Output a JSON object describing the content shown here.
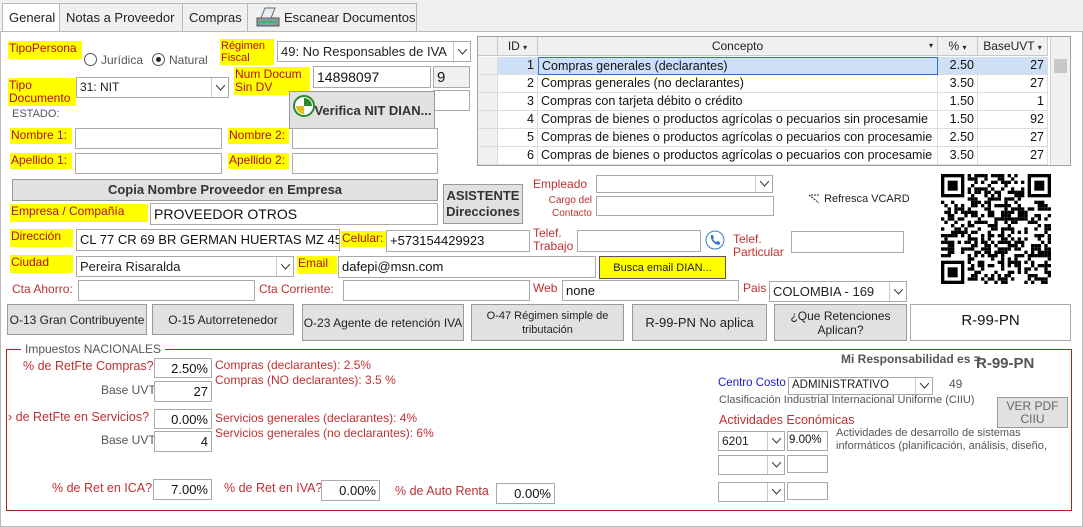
{
  "tabs": [
    {
      "label": "General"
    },
    {
      "label": "Notas a Proveedor"
    },
    {
      "label": "Compras"
    },
    {
      "label": "Escanear Documentos"
    }
  ],
  "tipo_persona": {
    "label": "TipoPersona",
    "opt1": "Jurídica",
    "opt2": "Natural",
    "selected": "Natural"
  },
  "regimen": {
    "label": "Régimen Fiscal",
    "value": "49: No Responsables de IVA"
  },
  "tipo_doc": {
    "label": "Tipo Documento",
    "value": "31: NIT"
  },
  "num_doc": {
    "label": "Num Docum Sin DV",
    "value": "14898097",
    "dv": "9"
  },
  "estado_label": "ESTADO:",
  "verifica_btn": "Verifica NIT DIAN...",
  "nombre1": {
    "label": "Nombre 1:",
    "value": ""
  },
  "nombre2": {
    "label": "Nombre 2:",
    "value": ""
  },
  "apellido1": {
    "label": "Apellido 1:",
    "value": ""
  },
  "apellido2": {
    "label": "Apellido 2:",
    "value": ""
  },
  "copia_btn": "Copia Nombre Proveedor en Empresa",
  "asistente_btn": "ASISTENTE Direcciones",
  "empresa": {
    "label": "Empresa / Compañía",
    "value": "PROVEEDOR OTROS"
  },
  "direccion": {
    "label": "Dirección",
    "value": "CL 77 CR 69 BR GERMAN HUERTAS MZ 45"
  },
  "celular": {
    "label": "Celular:",
    "value": "+573154429923"
  },
  "ciudad": {
    "label": "Ciudad",
    "value": "Pereira Risaralda"
  },
  "email": {
    "label": "Email",
    "value": "dafepi@msn.com"
  },
  "busca_email_btn": "Busca email DIAN...",
  "empleado": {
    "label": "Empleado",
    "value": ""
  },
  "cargo": {
    "label": "Cargo del Contacto",
    "value": ""
  },
  "tel_trabajo": {
    "label": "Telef. Trabajo",
    "value": ""
  },
  "tel_particular": {
    "label": "Telef. Particular",
    "value": ""
  },
  "refresca": "Refresca VCARD",
  "cta_ahorro": {
    "label": "Cta Ahorro:",
    "value": ""
  },
  "cta_corriente": {
    "label": "Cta Corriente:",
    "value": ""
  },
  "web": {
    "label": "Web",
    "value": "none"
  },
  "pais": {
    "label": "Pais",
    "value": "COLOMBIA - 169"
  },
  "resp_buttons": [
    "O-13 Gran Contribuyente",
    "O-15 Autorretenedor",
    "O-23 Agente de retención IVA",
    "O-47 Régimen simple de tributación",
    "R-99-PN No aplica",
    "¿Que Retenciones Aplican?"
  ],
  "resp_value": "R-99-PN",
  "grid": {
    "headers": [
      "ID",
      "Concepto",
      "%",
      "BaseUVT"
    ],
    "rows": [
      {
        "id": "1",
        "concepto": "Compras generales (declarantes)",
        "pct": "2.50",
        "uvt": "27"
      },
      {
        "id": "2",
        "concepto": "Compras generales (no declarantes)",
        "pct": "3.50",
        "uvt": "27"
      },
      {
        "id": "3",
        "concepto": "Compras con tarjeta débito o crédito",
        "pct": "1.50",
        "uvt": "1"
      },
      {
        "id": "4",
        "concepto": "Compras de bienes o productos agrícolas o pecuarios sin procesamie",
        "pct": "1.50",
        "uvt": "92"
      },
      {
        "id": "5",
        "concepto": "Compras de bienes o productos agrícolas o pecuarios con procesamie",
        "pct": "2.50",
        "uvt": "27"
      },
      {
        "id": "6",
        "concepto": "Compras de bienes o productos agrícolas o pecuarios con procesamie",
        "pct": "3.50",
        "uvt": "27"
      }
    ]
  },
  "impuestos": {
    "legend": "Impuestos NACIONALES",
    "retfte_compras": {
      "label": "% de RetFte Compras?",
      "value": "2.50%",
      "base_label": "Base UVT:",
      "base": "27",
      "note1": "Compras (declarantes): 2.5%",
      "note2": "Compras (NO declarantes): 3.5 %"
    },
    "retfte_servicios": {
      "label": "› de RetFte en Servicios?",
      "value": "0.00%",
      "base_label": "Base UVT:",
      "base": "4",
      "note1": "Servicios generales (declarantes): 4%",
      "note2": "Servicios generales (no declarantes): 6%"
    },
    "ret_ica": {
      "label": "% de Ret en ICA?",
      "value": "7.00%"
    },
    "ret_iva": {
      "label": "% de Ret en IVA?",
      "value": "0.00%"
    },
    "auto_renta": {
      "label": "% de Auto Renta",
      "value": "0.00%"
    },
    "mi_resp_label": "Mi Responsabilidad es =",
    "mi_resp_value": "R-99-PN",
    "centro_costo": {
      "label": "Centro Costo",
      "value": "ADMINISTRATIVO",
      "num": "49"
    },
    "ciiu_label": "Clasificación Industrial Internacional Uniforme (CIIU)",
    "ver_pdf_btn": "VER PDF CIIU",
    "actividades_label": "Actividades Económicas",
    "actividad1": {
      "code": "6201",
      "pct": "9.00%",
      "desc": "Actividades de desarrollo de sistemas informáticos (planificación, análisis, diseño,"
    }
  }
}
